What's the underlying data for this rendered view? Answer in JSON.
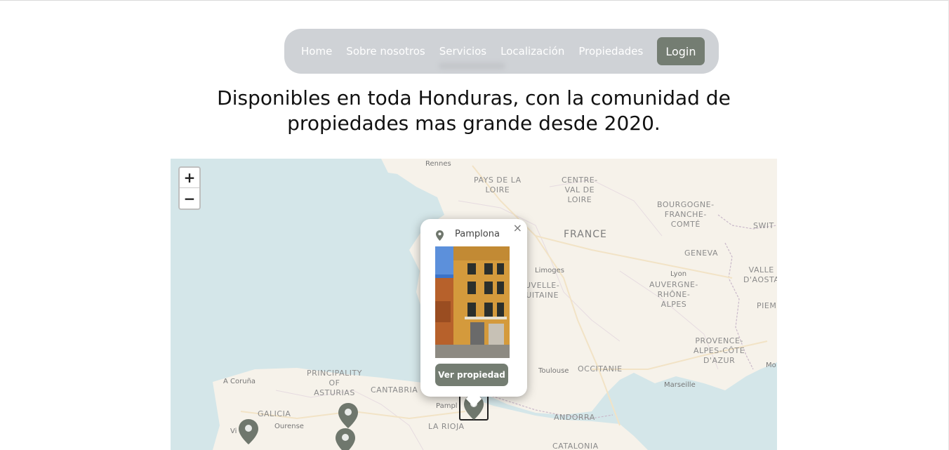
{
  "nav": {
    "links": [
      "Home",
      "Sobre nosotros",
      "Servicios",
      "Localización",
      "Propiedades"
    ],
    "login_label": "Login"
  },
  "headline": {
    "line1": "Disponibles en toda Honduras, con la comunidad de",
    "line2": "propiedades mas grande desde 2020."
  },
  "map": {
    "zoom_in": "+",
    "zoom_out": "−",
    "labels": {
      "rennes": "Rennes",
      "pays_de_la_loire": "PAYS DE LA\nLOIRE",
      "centre_val_de_loire": "CENTRE-\nVAL DE\nLOIRE",
      "bourgogne": "BOURGOGNE-\nFRANCHE-\nCOMTÉ",
      "switz": "SWIT",
      "france": "FRANCE",
      "geneva": "GENEVA",
      "limoges": "Limoges",
      "nouvelle_aquitaine": "UVELLE-\nUITAINE",
      "lyon": "Lyon",
      "auvergne": "AUVERGNE-\nRHÔNE-\nALPES",
      "valle_daosta": "VALLE\nD'AOSTA",
      "piem": "PIEM",
      "provence": "PROVENCE-\nALPES-CÔTE\nD'AZUR",
      "toulouse": "Toulouse",
      "occitanie": "OCCITANIE",
      "marseille": "Marseille",
      "mo": "Mo",
      "acoruna": "A Coruña",
      "asturias": "PRINCIPALITY\nOF\nASTURIAS",
      "cantabria": "CANTABRIA",
      "galicia": "GALICIA",
      "vigo": "Vi",
      "ourense": "Ourense",
      "pamplona_small": "Pampl",
      "la_rioja": "LA RIOJA",
      "andorra": "ANDORRA",
      "catalonia": "CATALONIA"
    },
    "popup": {
      "title": "Pamplona",
      "close": "×",
      "button": "Ver propiedad"
    }
  },
  "colors": {
    "accent": "#747d72",
    "navbar_bg": "#cfd2d6",
    "sea": "#d4e6e9",
    "land": "#f6f2ea"
  }
}
